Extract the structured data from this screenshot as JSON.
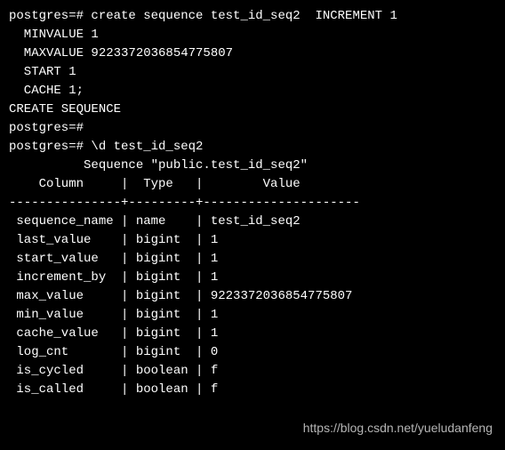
{
  "prompt": "postgres=#",
  "cmd_line1": "postgres=# create sequence test_id_seq2  INCREMENT 1",
  "cmd_line2": "  MINVALUE 1",
  "cmd_line3": "  MAXVALUE 9223372036854775807",
  "cmd_line4": "  START 1",
  "cmd_line5": "  CACHE 1;",
  "result_msg": "CREATE SEQUENCE",
  "prompt2": "postgres=#",
  "cmd2": "postgres=# \\d test_id_seq2",
  "seq_title": "          Sequence \"public.test_id_seq2\"",
  "header": "    Column     |  Type   |        Value",
  "divider": "---------------+---------+---------------------",
  "rows": [
    " sequence_name | name    | test_id_seq2",
    " last_value    | bigint  | 1",
    " start_value   | bigint  | 1",
    " increment_by  | bigint  | 1",
    " max_value     | bigint  | 9223372036854775807",
    " min_value     | bigint  | 1",
    " cache_value   | bigint  | 1",
    " log_cnt       | bigint  | 0",
    " is_cycled     | boolean | f",
    " is_called     | boolean | f"
  ],
  "watermark": "https://blog.csdn.net/yueludanfeng",
  "chart_data": {
    "type": "table",
    "title": "Sequence \"public.test_id_seq2\"",
    "columns": [
      "Column",
      "Type",
      "Value"
    ],
    "rows": [
      {
        "Column": "sequence_name",
        "Type": "name",
        "Value": "test_id_seq2"
      },
      {
        "Column": "last_value",
        "Type": "bigint",
        "Value": "1"
      },
      {
        "Column": "start_value",
        "Type": "bigint",
        "Value": "1"
      },
      {
        "Column": "increment_by",
        "Type": "bigint",
        "Value": "1"
      },
      {
        "Column": "max_value",
        "Type": "bigint",
        "Value": "9223372036854775807"
      },
      {
        "Column": "min_value",
        "Type": "bigint",
        "Value": "1"
      },
      {
        "Column": "cache_value",
        "Type": "bigint",
        "Value": "1"
      },
      {
        "Column": "log_cnt",
        "Type": "bigint",
        "Value": "0"
      },
      {
        "Column": "is_cycled",
        "Type": "boolean",
        "Value": "f"
      },
      {
        "Column": "is_called",
        "Type": "boolean",
        "Value": "f"
      }
    ]
  }
}
